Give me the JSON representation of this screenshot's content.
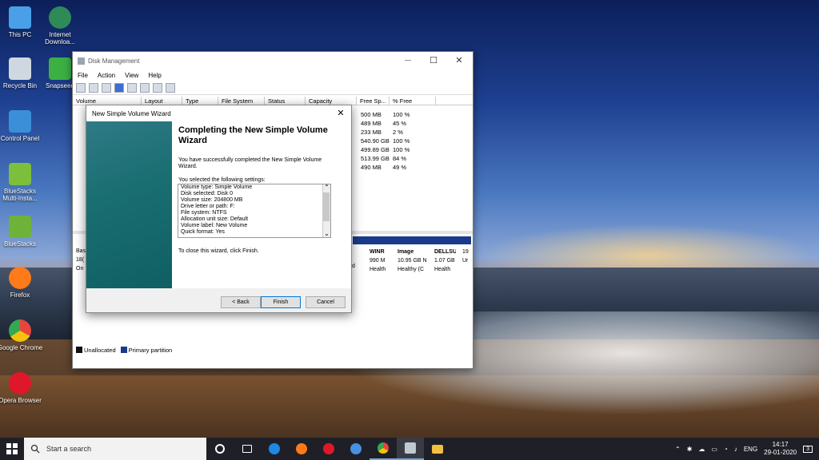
{
  "desktop": {
    "icons": [
      {
        "label": "This PC",
        "icon": "pc-icon",
        "color": "#4aa0e6"
      },
      {
        "label": "Internet Downloa...",
        "icon": "idm-icon",
        "color": "#2e8b57"
      },
      {
        "label": "Recycle Bin",
        "icon": "recycle-bin-icon",
        "color": "#cfd8e0"
      },
      {
        "label": "Snapseed",
        "icon": "snapseed-icon",
        "color": "#3cb043"
      },
      {
        "label": "Control Panel",
        "icon": "control-panel-icon",
        "color": "#3a8fd8"
      },
      {
        "label": "BlueStacks Multi-Insta...",
        "icon": "bluestacks-icon",
        "color": "#7cbf3a"
      },
      {
        "label": "BlueStacks",
        "icon": "bluestacks-icon",
        "color": "#6fb23a"
      },
      {
        "label": "Firefox",
        "icon": "firefox-icon",
        "color": "#ff7a1a"
      },
      {
        "label": "Google Chrome",
        "icon": "chrome-icon",
        "color": "#e8453c"
      },
      {
        "label": "Opera Browser",
        "icon": "opera-icon",
        "color": "#e0172b"
      }
    ]
  },
  "disk_mgmt": {
    "title": "Disk Management",
    "controls": {
      "minimize": "—",
      "maximize": "☐",
      "close": "✕"
    },
    "menu": [
      "File",
      "Action",
      "View",
      "Help"
    ],
    "columns": [
      "Volume",
      "Layout",
      "Type",
      "File System",
      "Status",
      "Capacity",
      "Free Sp...",
      "% Free"
    ],
    "rows": [
      {
        "free": "500 MB",
        "pct": "100 %"
      },
      {
        "free": "489 MB",
        "pct": "45 %"
      },
      {
        "free": "233 MB",
        "pct": "2 %"
      },
      {
        "free": "540.90 GB",
        "pct": "100 %"
      },
      {
        "free": "499.89 GB",
        "pct": "100 %"
      },
      {
        "free": "513.99 GB",
        "pct": "84 %"
      },
      {
        "free": "490 MB",
        "pct": "49 %"
      }
    ],
    "disk_label": {
      "name": "Bas",
      "size": "18(",
      "state": "On"
    },
    "partitions": [
      {
        "name": "WINR",
        "size": "990 M",
        "status": "Health"
      },
      {
        "name": "Image",
        "size": "10.95 GB N",
        "status": "Healthy (C"
      },
      {
        "name": "DELLSU",
        "size": "1.07 GB",
        "status": "Health"
      },
      {
        "name": "",
        "size": "19",
        "status": "Ur"
      }
    ],
    "partition_stub": "d",
    "legend": [
      {
        "label": "Unallocated",
        "color": "#111111"
      },
      {
        "label": "Primary partition",
        "color": "#1b3a8c"
      }
    ]
  },
  "wizard": {
    "title": "New Simple Volume Wizard",
    "close": "✕",
    "heading": "Completing the New Simple Volume Wizard",
    "message": "You have successfully completed the New Simple Volume Wizard.",
    "settings_label": "You selected the following settings:",
    "settings": [
      "Volume type: Simple Volume",
      "Disk selected: Disk 0",
      "Volume size: 204800 MB",
      "Drive letter or path: F:",
      "File system: NTFS",
      "Allocation unit size: Default",
      "Volume label: New Volume",
      "Quick format: Yes"
    ],
    "scroll_up": "⌃",
    "scroll_down": "⌄",
    "close_msg": "To close this wizard, click Finish.",
    "buttons": {
      "back": "< Back",
      "finish": "Finish",
      "cancel": "Cancel"
    }
  },
  "taskbar": {
    "start_icon": "windows-icon",
    "search_placeholder": "Start a search",
    "apps": [
      {
        "name": "cortana-icon",
        "color": "#ffffff"
      },
      {
        "name": "task-view-icon",
        "color": "#ffffff"
      },
      {
        "name": "edge-icon",
        "color": "#1e88e5"
      },
      {
        "name": "firefox-icon",
        "color": "#ff7a1a"
      },
      {
        "name": "opera-icon",
        "color": "#e0172b"
      },
      {
        "name": "browser-icon",
        "color": "#4a90e2"
      },
      {
        "name": "chrome-icon",
        "color": "#e8453c"
      },
      {
        "name": "disk-management-icon",
        "color": "#c0c8d0"
      },
      {
        "name": "file-explorer-icon",
        "color": "#f0c040"
      }
    ],
    "tray": {
      "lang": "ENG",
      "time": "14:17",
      "date": "29-01-2020",
      "notifications": "3"
    }
  }
}
